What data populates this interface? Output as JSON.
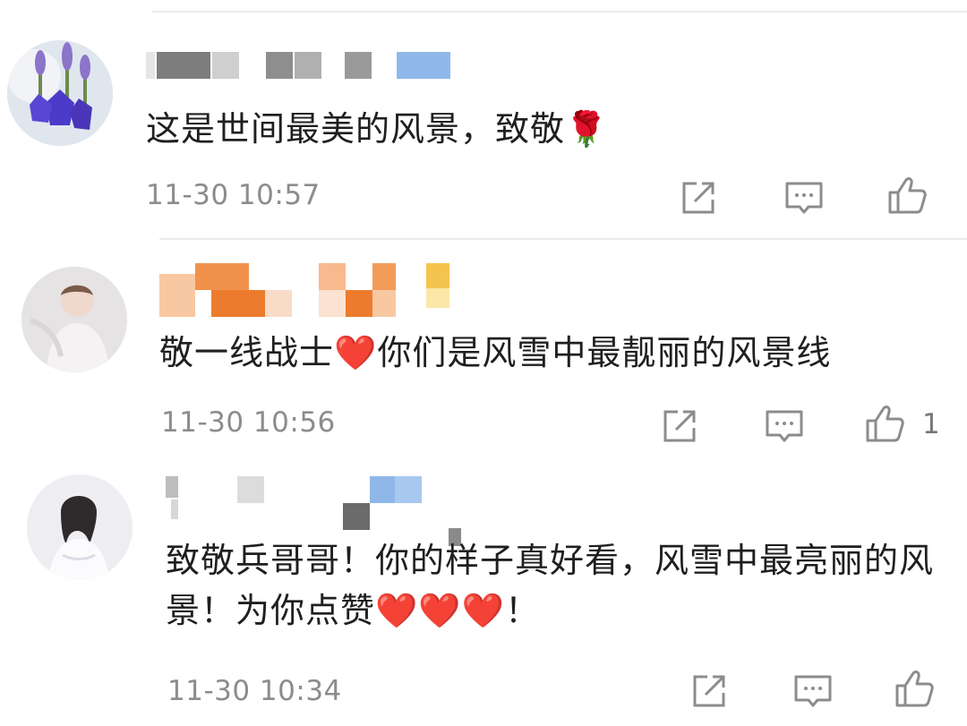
{
  "comments": [
    {
      "avatar_icon": "lavender-flower-avatar",
      "text": "这是世间最美的风景，致敬🌹",
      "time": "11-30 10:57",
      "like_count": ""
    },
    {
      "avatar_icon": "person-photo-avatar",
      "text": "敬一线战士❤️你们是风雪中最靓丽的风景线",
      "time": "11-30 10:56",
      "like_count": "1"
    },
    {
      "avatar_icon": "person-photo-avatar",
      "text": "致敬兵哥哥！你的样子真好看，风雪中最亮丽的风景！为你点赞❤️❤️❤️！",
      "time": "11-30 10:34",
      "like_count": ""
    }
  ],
  "icons": {
    "share": "share-icon",
    "reply": "comment-icon",
    "like": "thumbs-up-icon"
  },
  "colors": {
    "text": "#1f1f1f",
    "meta": "#8c8c8c",
    "divider": "#ececec",
    "accent_red": "#e0252d"
  }
}
